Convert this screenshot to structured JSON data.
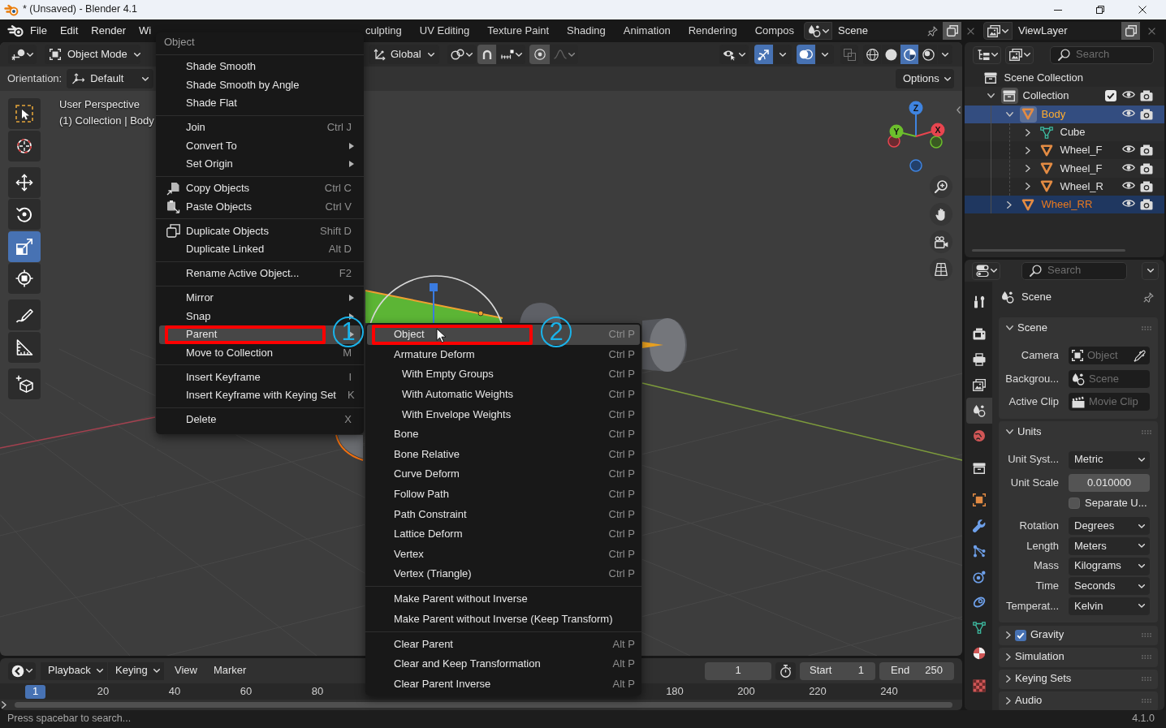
{
  "window": {
    "title": "* (Unsaved) - Blender 4.1"
  },
  "top_bar": {
    "menus": [
      "File",
      "Edit",
      "Render",
      "Wi"
    ],
    "workspaces": [
      {
        "label": "culpting",
        "selected": false
      },
      {
        "label": "UV Editing",
        "selected": false
      },
      {
        "label": "Texture Paint",
        "selected": false
      },
      {
        "label": "Shading",
        "selected": false
      },
      {
        "label": "Animation",
        "selected": false
      },
      {
        "label": "Rendering",
        "selected": false
      },
      {
        "label": "Compos",
        "selected": false
      }
    ],
    "scene": "Scene",
    "view_layer": "ViewLayer"
  },
  "viewport": {
    "header": {
      "mode": "Object Mode",
      "transform_orientation": "Global",
      "snapping": false,
      "proportional_editing": false,
      "gizmos": true,
      "overlays": true,
      "xray": false,
      "shading": [
        {
          "kind": "wireframe",
          "selected": false
        },
        {
          "kind": "solid",
          "selected": false
        },
        {
          "kind": "material",
          "selected": true
        },
        {
          "kind": "rendered",
          "selected": false
        }
      ]
    },
    "tool_settings": {
      "orientation_label": "Orientation:",
      "orientation": "Default",
      "options": "Options"
    },
    "tools": [
      [
        {
          "kind": "select-box",
          "selected": false
        },
        {
          "kind": "cursor",
          "selected": false
        }
      ],
      [
        {
          "kind": "move",
          "selected": false
        },
        {
          "kind": "rotate",
          "selected": false
        },
        {
          "kind": "scale",
          "selected": true
        },
        {
          "kind": "transform",
          "selected": false
        }
      ],
      [
        {
          "kind": "annotate",
          "selected": false
        },
        {
          "kind": "measure",
          "selected": false
        }
      ],
      [
        {
          "kind": "add-cube",
          "selected": false
        }
      ]
    ],
    "overlay_text": {
      "view": "User Perspective",
      "context": "(1) Collection | Body"
    },
    "navigation_gizmo": [
      {
        "kind": "z",
        "label": "Z"
      },
      {
        "kind": "y",
        "label": "Y"
      },
      {
        "kind": "x",
        "label": "X"
      }
    ]
  },
  "context_menu": {
    "title": "Object",
    "groups": [
      [
        {
          "label": "Shade Smooth",
          "kind": "text",
          "submenu": false,
          "selected": false
        },
        {
          "label": "Shade Smooth by Angle",
          "kind": "text",
          "submenu": false,
          "selected": false
        },
        {
          "label": "Shade Flat",
          "kind": "text",
          "submenu": false,
          "selected": false
        }
      ],
      [
        {
          "label": "Join",
          "kind": "text",
          "shortcut": "Ctrl J",
          "submenu": false,
          "selected": false
        },
        {
          "label": "Convert To",
          "kind": "text",
          "submenu": true,
          "selected": false
        },
        {
          "label": "Set Origin",
          "kind": "text",
          "submenu": true,
          "selected": false
        }
      ],
      [
        {
          "label": "Copy Objects",
          "kind": "copy",
          "shortcut": "Ctrl C",
          "submenu": false,
          "selected": false
        },
        {
          "label": "Paste Objects",
          "kind": "paste",
          "shortcut": "Ctrl V",
          "submenu": false,
          "selected": false
        }
      ],
      [
        {
          "label": "Duplicate Objects",
          "kind": "duplicate",
          "shortcut": "Shift D",
          "submenu": false,
          "selected": false
        },
        {
          "label": "Duplicate Linked",
          "kind": "text",
          "shortcut": "Alt D",
          "submenu": false,
          "selected": false
        }
      ],
      [
        {
          "label": "Rename Active Object...",
          "kind": "text",
          "shortcut": "F2",
          "submenu": false,
          "selected": false
        }
      ],
      [
        {
          "label": "Mirror",
          "kind": "text",
          "submenu": true,
          "selected": false
        },
        {
          "label": "Snap",
          "kind": "text",
          "submenu": true,
          "selected": false
        },
        {
          "label": "Parent",
          "kind": "text",
          "submenu": true,
          "selected": true
        },
        {
          "label": "Move to Collection",
          "kind": "text",
          "shortcut": "M",
          "submenu": false,
          "selected": false
        }
      ],
      [
        {
          "label": "Insert Keyframe",
          "kind": "text",
          "shortcut": "I",
          "submenu": false,
          "selected": false
        },
        {
          "label": "Insert Keyframe with Keying Set",
          "kind": "text",
          "shortcut": "K",
          "submenu": false,
          "selected": false
        }
      ],
      [
        {
          "label": "Delete",
          "kind": "text",
          "shortcut": "X",
          "submenu": false,
          "selected": false
        }
      ]
    ]
  },
  "submenu": {
    "groups": [
      [
        {
          "label": "Object",
          "shortcut": "Ctrl P",
          "selected": true
        },
        {
          "label": "Armature Deform",
          "shortcut": "Ctrl P",
          "selected": false,
          "children": [
            {
              "label": "With Empty Groups",
              "shortcut": "Ctrl P",
              "selected": false
            },
            {
              "label": "With Automatic Weights",
              "shortcut": "Ctrl P",
              "selected": false
            },
            {
              "label": "With Envelope Weights",
              "shortcut": "Ctrl P",
              "selected": false
            }
          ]
        },
        {
          "label": "Bone",
          "shortcut": "Ctrl P",
          "selected": false
        },
        {
          "label": "Bone Relative",
          "shortcut": "Ctrl P",
          "selected": false
        },
        {
          "label": "Curve Deform",
          "shortcut": "Ctrl P",
          "selected": false
        },
        {
          "label": "Follow Path",
          "shortcut": "Ctrl P",
          "selected": false
        },
        {
          "label": "Path Constraint",
          "shortcut": "Ctrl P",
          "selected": false
        },
        {
          "label": "Lattice Deform",
          "shortcut": "Ctrl P",
          "selected": false
        },
        {
          "label": "Vertex",
          "shortcut": "Ctrl P",
          "selected": false
        },
        {
          "label": "Vertex (Triangle)",
          "shortcut": "Ctrl P",
          "selected": false
        }
      ],
      [
        {
          "label": "Make Parent without Inverse",
          "selected": false
        },
        {
          "label": "Make Parent without Inverse (Keep Transform)",
          "selected": false
        }
      ],
      [
        {
          "label": "Clear Parent",
          "shortcut": "Alt P",
          "selected": false
        },
        {
          "label": "Clear and Keep Transformation",
          "shortcut": "Alt P",
          "selected": false
        },
        {
          "label": "Clear Parent Inverse",
          "shortcut": "Alt P",
          "selected": false
        }
      ]
    ]
  },
  "annotations": [
    {
      "label": "1"
    },
    {
      "label": "2"
    }
  ],
  "timeline": {
    "menus": [
      {
        "label": "Playback",
        "kind": "dropdown"
      },
      {
        "label": "Keying",
        "kind": "dropdown"
      },
      {
        "label": "View",
        "kind": "menu"
      },
      {
        "label": "Marker",
        "kind": "menu"
      }
    ],
    "current_frame": "1",
    "auto_keying": false,
    "start_label": "Start",
    "start": "1",
    "end_label": "End",
    "end": "250",
    "playhead": "1",
    "ruler_labels": [
      [
        "20",
        "40",
        "60",
        "80"
      ],
      [
        "180",
        "200",
        "220",
        "240"
      ]
    ]
  },
  "outliner": {
    "search_placeholder": "Search",
    "root": {
      "label": "Scene Collection",
      "children": [
        {
          "label": "Collection",
          "kind": "collection",
          "expanded": true,
          "checked": true,
          "selected": false,
          "active": true,
          "children": [
            {
              "label": "Body",
              "kind": "object",
              "expanded": true,
              "selected": true,
              "active": true,
              "children": [
                {
                  "label": "Cube",
                  "kind": "mesh",
                  "expanded": false,
                  "selected": false,
                  "active": false
                },
                {
                  "label": "Wheel_F",
                  "kind": "object",
                  "expanded": false,
                  "selected": false,
                  "active": false
                },
                {
                  "label": "Wheel_F",
                  "kind": "object",
                  "expanded": false,
                  "selected": false,
                  "active": false
                },
                {
                  "label": "Wheel_R",
                  "kind": "object",
                  "expanded": false,
                  "selected": false,
                  "active": false
                }
              ]
            },
            {
              "label": "Wheel_RR",
              "kind": "object",
              "expanded": false,
              "selected": true,
              "active": false
            }
          ]
        }
      ]
    }
  },
  "properties": {
    "search_placeholder": "Search",
    "tabs": [
      [
        {
          "kind": "tool",
          "selected": false
        }
      ],
      [
        {
          "kind": "render",
          "selected": false
        },
        {
          "kind": "output",
          "selected": false
        },
        {
          "kind": "view-layer",
          "selected": false
        },
        {
          "kind": "scene",
          "selected": true
        },
        {
          "kind": "world",
          "selected": false
        }
      ],
      [
        {
          "kind": "collection",
          "selected": false
        }
      ],
      [
        {
          "kind": "object",
          "selected": false
        },
        {
          "kind": "modifiers",
          "selected": false
        },
        {
          "kind": "particles",
          "selected": false
        },
        {
          "kind": "physics",
          "selected": false
        },
        {
          "kind": "constraints",
          "selected": false
        },
        {
          "kind": "data",
          "selected": false
        },
        {
          "kind": "material",
          "selected": false
        }
      ],
      [
        {
          "kind": "texture",
          "selected": false
        }
      ]
    ],
    "context": "Scene",
    "panels": [
      {
        "title": "Scene",
        "kind": "panel",
        "expanded": true,
        "row_groups": [
          [
            {
              "kind": "object-picker",
              "label": "Camera",
              "placeholder": "Object"
            }
          ],
          [
            {
              "kind": "scene-picker",
              "label": "Backgrou...",
              "placeholder": "Scene"
            }
          ],
          [
            {
              "kind": "clip-picker",
              "label": "Active Clip",
              "placeholder": "Movie Clip"
            }
          ]
        ]
      },
      {
        "title": "Units",
        "kind": "panel",
        "expanded": true,
        "row_groups": [
          [
            {
              "kind": "dropdown",
              "label": "Unit Syst...",
              "value": "Metric"
            }
          ],
          [
            {
              "kind": "number",
              "label": "Unit Scale",
              "value": "0.010000"
            },
            {
              "kind": "checkbox",
              "label": "Separate U...",
              "checked": false
            }
          ],
          [
            {
              "kind": "dropdown",
              "label": "Rotation",
              "value": "Degrees"
            },
            {
              "kind": "dropdown",
              "label": "Length",
              "value": "Meters"
            },
            {
              "kind": "dropdown",
              "label": "Mass",
              "value": "Kilograms"
            },
            {
              "kind": "dropdown",
              "label": "Time",
              "value": "Seconds"
            },
            {
              "kind": "dropdown",
              "label": "Temperat...",
              "value": "Kelvin"
            }
          ]
        ]
      },
      {
        "title": "Gravity",
        "kind": "checkbox-panel",
        "expanded": false,
        "checked": true
      },
      {
        "title": "Simulation",
        "kind": "panel",
        "expanded": false
      },
      {
        "title": "Keying Sets",
        "kind": "panel",
        "expanded": false
      },
      {
        "title": "Audio",
        "kind": "panel",
        "expanded": false
      }
    ]
  },
  "status_bar": {
    "hint": "Press spacebar to search...",
    "version": "4.1.0"
  }
}
